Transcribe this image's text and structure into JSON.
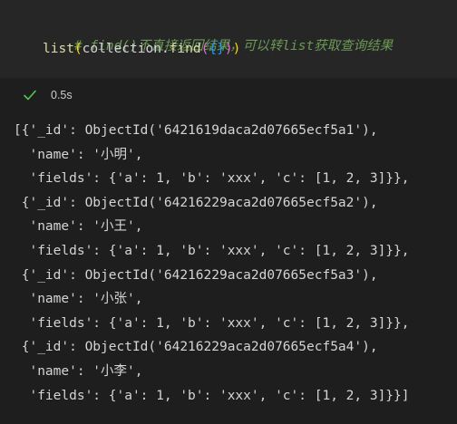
{
  "cell": {
    "comment": "# find()不直接返回结果，可以转list获取查询结果",
    "code": {
      "fn_list": "list",
      "open1": "(",
      "var_collection": "collection",
      "dot": ".",
      "fn_find": "find",
      "open2": "(",
      "brace": "{}",
      "close2": ")",
      "close1": ")"
    }
  },
  "status": {
    "icon": "check-icon",
    "success_color": "#4ec94e",
    "exec_time": "0.5s"
  },
  "output": {
    "lines": [
      "[{'_id': ObjectId('6421619daca2d07665ecf5a1'),",
      "  'name': '小明',",
      "  'fields': {'a': 1, 'b': 'xxx', 'c': [1, 2, 3]}},",
      " {'_id': ObjectId('64216229aca2d07665ecf5a2'),",
      "  'name': '小王',",
      "  'fields': {'a': 1, 'b': 'xxx', 'c': [1, 2, 3]}},",
      " {'_id': ObjectId('64216229aca2d07665ecf5a3'),",
      "  'name': '小张',",
      "  'fields': {'a': 1, 'b': 'xxx', 'c': [1, 2, 3]}},",
      " {'_id': ObjectId('64216229aca2d07665ecf5a4'),",
      "  'name': '小李',",
      "  'fields': {'a': 1, 'b': 'xxx', 'c': [1, 2, 3]}}]"
    ]
  }
}
